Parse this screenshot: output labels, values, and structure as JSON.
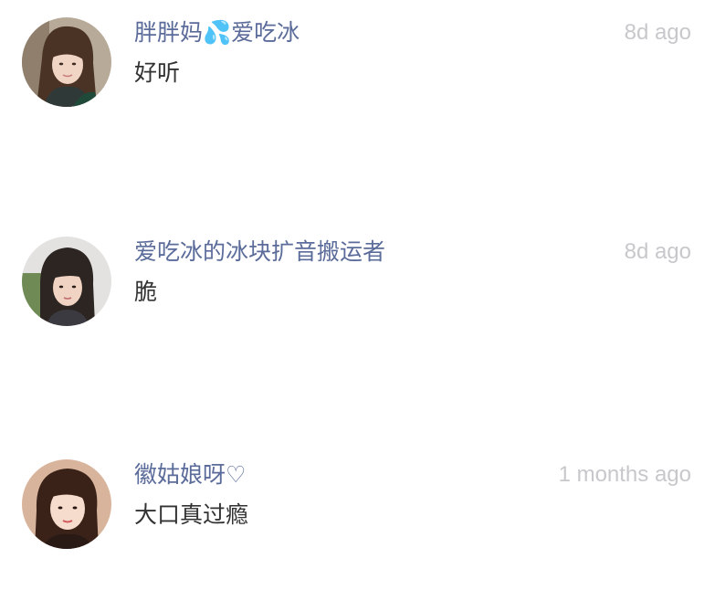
{
  "comments": [
    {
      "username": "胖胖妈💦爱吃冰",
      "text": "好听",
      "time": "8d ago",
      "avatar_icon": "user-photo-avatar"
    },
    {
      "username": "爱吃冰的冰块扩音搬运者",
      "text": "脆",
      "time": "8d ago",
      "avatar_icon": "user-photo-avatar"
    },
    {
      "username": "徽姑娘呀♡",
      "text": "大口真过瘾",
      "time": "1 months ago",
      "avatar_icon": "user-photo-avatar"
    }
  ],
  "colors": {
    "username": "#5b6c9a",
    "text": "#333333",
    "time": "#c8c8cc",
    "background": "#ffffff"
  }
}
